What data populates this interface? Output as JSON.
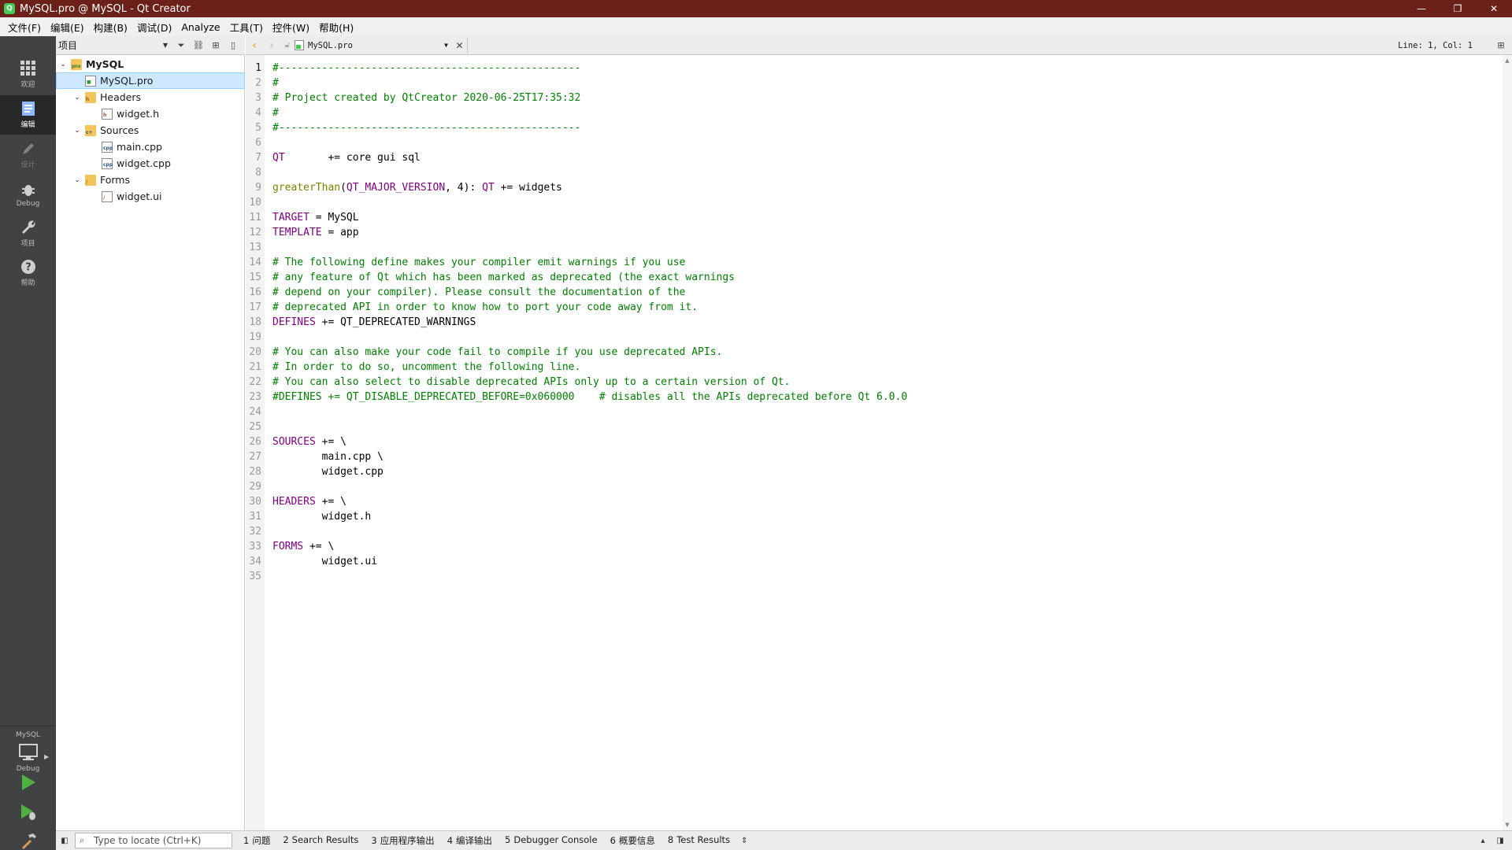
{
  "window": {
    "title": "MySQL.pro @ MySQL - Qt Creator",
    "controls": [
      "—",
      "❐",
      "✕"
    ]
  },
  "menu": [
    "文件(F)",
    "编辑(E)",
    "构建(B)",
    "调试(D)",
    "Analyze",
    "工具(T)",
    "控件(W)",
    "帮助(H)"
  ],
  "modes": {
    "welcome": "欢迎",
    "edit": "编辑",
    "design": "设计",
    "debug": "Debug",
    "projects": "项目",
    "help": "帮助"
  },
  "kit": {
    "project": "MySQL",
    "config": "Debug"
  },
  "project_panel": {
    "view_selector": "项目",
    "tree": {
      "root": "MySQL",
      "pro_file": "MySQL.pro",
      "headers": "Headers",
      "header_files": [
        "widget.h"
      ],
      "sources": "Sources",
      "source_files": [
        "main.cpp",
        "widget.cpp"
      ],
      "forms": "Forms",
      "form_files": [
        "widget.ui"
      ]
    }
  },
  "editor": {
    "document": "MySQL.pro",
    "position": "Line: 1, Col: 1",
    "lines": [
      {
        "n": "1",
        "parts": [
          [
            "c-comment",
            "#-------------------------------------------------"
          ]
        ]
      },
      {
        "n": "2",
        "parts": [
          [
            "c-comment",
            "#"
          ]
        ]
      },
      {
        "n": "3",
        "parts": [
          [
            "c-comment",
            "# Project created by QtCreator 2020-06-25T17:35:32"
          ]
        ]
      },
      {
        "n": "4",
        "parts": [
          [
            "c-comment",
            "#"
          ]
        ]
      },
      {
        "n": "5",
        "parts": [
          [
            "c-comment",
            "#-------------------------------------------------"
          ]
        ]
      },
      {
        "n": "6",
        "parts": []
      },
      {
        "n": "7",
        "parts": [
          [
            "c-var",
            "QT"
          ],
          [
            "c-plain",
            "       += core gui sql"
          ]
        ]
      },
      {
        "n": "8",
        "parts": []
      },
      {
        "n": "9",
        "parts": [
          [
            "c-func",
            "greaterThan"
          ],
          [
            "c-plain",
            "("
          ],
          [
            "c-var",
            "QT_MAJOR_VERSION"
          ],
          [
            "c-plain",
            ", 4): "
          ],
          [
            "c-var",
            "QT"
          ],
          [
            "c-plain",
            " += widgets"
          ]
        ]
      },
      {
        "n": "10",
        "parts": []
      },
      {
        "n": "11",
        "parts": [
          [
            "c-var",
            "TARGET"
          ],
          [
            "c-plain",
            " = MySQL"
          ]
        ]
      },
      {
        "n": "12",
        "parts": [
          [
            "c-var",
            "TEMPLATE"
          ],
          [
            "c-plain",
            " = app"
          ]
        ]
      },
      {
        "n": "13",
        "parts": []
      },
      {
        "n": "14",
        "parts": [
          [
            "c-comment",
            "# The following define makes your compiler emit warnings if you use"
          ]
        ]
      },
      {
        "n": "15",
        "parts": [
          [
            "c-comment",
            "# any feature of Qt which has been marked as deprecated (the exact warnings"
          ]
        ]
      },
      {
        "n": "16",
        "parts": [
          [
            "c-comment",
            "# depend on your compiler). Please consult the documentation of the"
          ]
        ]
      },
      {
        "n": "17",
        "parts": [
          [
            "c-comment",
            "# deprecated API in order to know how to port your code away from it."
          ]
        ]
      },
      {
        "n": "18",
        "parts": [
          [
            "c-var",
            "DEFINES"
          ],
          [
            "c-plain",
            " += QT_DEPRECATED_WARNINGS"
          ]
        ]
      },
      {
        "n": "19",
        "parts": []
      },
      {
        "n": "20",
        "parts": [
          [
            "c-comment",
            "# You can also make your code fail to compile if you use deprecated APIs."
          ]
        ]
      },
      {
        "n": "21",
        "parts": [
          [
            "c-comment",
            "# In order to do so, uncomment the following line."
          ]
        ]
      },
      {
        "n": "22",
        "parts": [
          [
            "c-comment",
            "# You can also select to disable deprecated APIs only up to a certain version of Qt."
          ]
        ]
      },
      {
        "n": "23",
        "parts": [
          [
            "c-comment",
            "#DEFINES += QT_DISABLE_DEPRECATED_BEFORE=0x060000    # disables all the APIs deprecated before Qt 6.0.0"
          ]
        ]
      },
      {
        "n": "24",
        "parts": []
      },
      {
        "n": "25",
        "parts": []
      },
      {
        "n": "26",
        "parts": [
          [
            "c-var",
            "SOURCES"
          ],
          [
            "c-plain",
            " += \\"
          ]
        ]
      },
      {
        "n": "27",
        "parts": [
          [
            "c-plain",
            "        main.cpp \\"
          ]
        ]
      },
      {
        "n": "28",
        "parts": [
          [
            "c-plain",
            "        widget.cpp"
          ]
        ]
      },
      {
        "n": "29",
        "parts": []
      },
      {
        "n": "30",
        "parts": [
          [
            "c-var",
            "HEADERS"
          ],
          [
            "c-plain",
            " += \\"
          ]
        ]
      },
      {
        "n": "31",
        "parts": [
          [
            "c-plain",
            "        widget.h"
          ]
        ]
      },
      {
        "n": "32",
        "parts": []
      },
      {
        "n": "33",
        "parts": [
          [
            "c-var",
            "FORMS"
          ],
          [
            "c-plain",
            " += \\"
          ]
        ]
      },
      {
        "n": "34",
        "parts": [
          [
            "c-plain",
            "        widget.ui"
          ]
        ]
      },
      {
        "n": "35",
        "parts": []
      }
    ]
  },
  "statusbar": {
    "locator_placeholder": "Type to locate (Ctrl+K)",
    "tabs": [
      {
        "num": "1",
        "label": "问题"
      },
      {
        "num": "2",
        "label": "Search Results"
      },
      {
        "num": "3",
        "label": "应用程序输出"
      },
      {
        "num": "4",
        "label": "编译输出"
      },
      {
        "num": "5",
        "label": "Debugger Console"
      },
      {
        "num": "6",
        "label": "概要信息"
      },
      {
        "num": "8",
        "label": "Test Results"
      }
    ]
  },
  "colors": {
    "titlebar": "#6b2019",
    "modebar": "#404244",
    "comment": "#008000",
    "variable": "#800080",
    "function": "#808000",
    "selection": "#cde8ff"
  }
}
